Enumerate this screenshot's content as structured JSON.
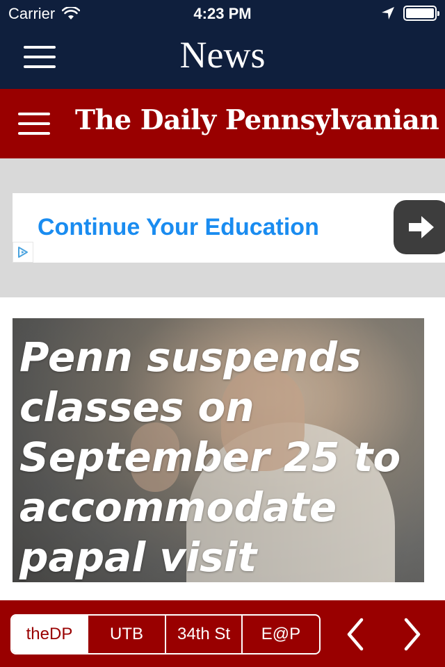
{
  "status_bar": {
    "carrier": "Carrier",
    "time": "4:23 PM",
    "icons": [
      "wifi-icon",
      "location-arrow-icon",
      "battery-icon"
    ]
  },
  "nav": {
    "title": "News",
    "menu_icon": "hamburger-icon"
  },
  "masthead": {
    "brand": "The Daily Pennsylvanian",
    "menu_icon": "hamburger-icon"
  },
  "ad": {
    "text": "Continue Your Education",
    "badge_icon": "adchoices-icon",
    "arrow_icon": "arrow-right-icon"
  },
  "story": {
    "headline": "Penn suspends classes on September 25 to accommodate papal visit"
  },
  "toolbar": {
    "segments": [
      {
        "label": "theDP",
        "selected": true
      },
      {
        "label": "UTB",
        "selected": false
      },
      {
        "label": "34th St",
        "selected": false
      },
      {
        "label": "E@P",
        "selected": false
      }
    ],
    "prev_icon": "chevron-left-icon",
    "next_icon": "chevron-right-icon"
  },
  "colors": {
    "nav_background": "#0f1f3d",
    "brand_red": "#990000",
    "ad_text": "#1a8cf0",
    "ad_background": "#d9d9d9"
  }
}
